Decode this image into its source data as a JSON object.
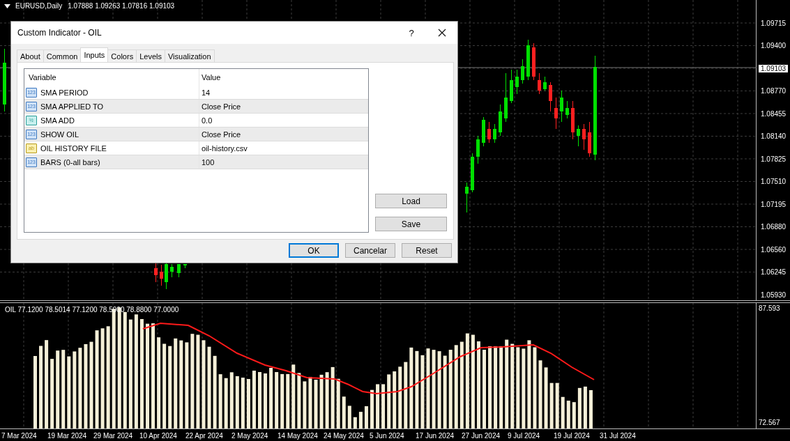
{
  "chart": {
    "symbol": "EURUSD,Daily",
    "ohlc": "1.07888 1.09263 1.07816 1.09103"
  },
  "price_axis": [
    {
      "label": "1.09715",
      "kind": "tick"
    },
    {
      "label": "1.09400",
      "kind": "tick"
    },
    {
      "label": "1.09103",
      "kind": "current"
    },
    {
      "label": "1.08770",
      "kind": "tick"
    },
    {
      "label": "1.08455",
      "kind": "tick"
    },
    {
      "label": "1.08140",
      "kind": "tick"
    },
    {
      "label": "1.07825",
      "kind": "tick"
    },
    {
      "label": "1.07510",
      "kind": "tick"
    },
    {
      "label": "1.07195",
      "kind": "tick"
    },
    {
      "label": "1.06880",
      "kind": "tick"
    },
    {
      "label": "1.06560",
      "kind": "tick"
    },
    {
      "label": "1.06245",
      "kind": "tick"
    },
    {
      "label": "1.05930",
      "kind": "tick"
    }
  ],
  "indicator": {
    "header": "OIL 77.1200 78.5014 77.1200 78.5900 78.8800 77.0000",
    "axis_max": "87.593",
    "axis_min": "72.567"
  },
  "date_axis": [
    "7 Mar 2024",
    "19 Mar 2024",
    "29 Mar 2024",
    "10 Apr 2024",
    "22 Apr 2024",
    "2 May 2024",
    "14 May 2024",
    "24 May 2024",
    "5 Jun 2024",
    "17 Jun 2024",
    "27 Jun 2024",
    "9 Jul 2024",
    "19 Jul 2024",
    "31 Jul 2024"
  ],
  "dialog": {
    "title": "Custom Indicator - OIL",
    "help": "?",
    "tabs": [
      {
        "label": "About",
        "selected": false
      },
      {
        "label": "Common",
        "selected": false
      },
      {
        "label": "Inputs",
        "selected": true
      },
      {
        "label": "Colors",
        "selected": false
      },
      {
        "label": "Levels",
        "selected": false
      },
      {
        "label": "Visualization",
        "selected": false
      }
    ],
    "table": {
      "columns": [
        "Variable",
        "Value"
      ],
      "rows": [
        {
          "kind": "integer",
          "icon": "123",
          "variable": "SMA PERIOD",
          "value": "14"
        },
        {
          "kind": "integer",
          "icon": "123",
          "variable": "SMA APPLIED TO",
          "value": "Close Price"
        },
        {
          "kind": "double",
          "icon": "½",
          "variable": "SMA ADD",
          "value": "0.0"
        },
        {
          "kind": "integer",
          "icon": "123",
          "variable": "SHOW OIL",
          "value": "Close Price"
        },
        {
          "kind": "string",
          "icon": "ab",
          "variable": "OIL HISTORY FILE",
          "value": "oil-history.csv"
        },
        {
          "kind": "integer",
          "icon": "123",
          "variable": "BARS (0-all bars)",
          "value": "100"
        }
      ]
    },
    "side_buttons": [
      "Load",
      "Save"
    ],
    "buttons": [
      {
        "label": "OK",
        "default": true
      },
      {
        "label": "Cancelar",
        "default": false
      },
      {
        "label": "Reset",
        "default": false
      }
    ]
  }
}
